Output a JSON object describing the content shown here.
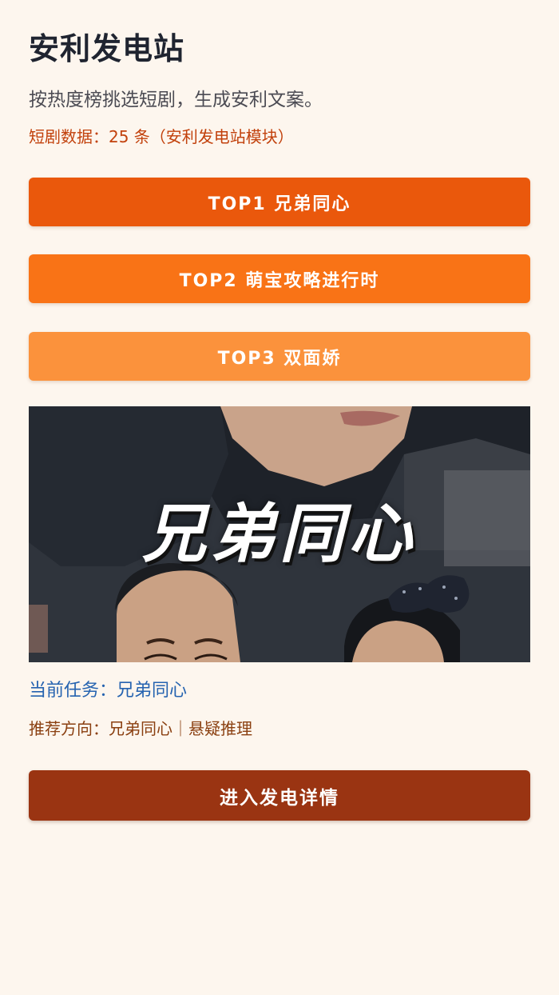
{
  "header": {
    "title": "安利发电站",
    "subtitle": "按热度榜挑选短剧，生成安利文案。",
    "stats": "短剧数据：25 条（安利发电站模块）"
  },
  "top_list": [
    {
      "label": "TOP1 兄弟同心",
      "color": "#ea580c"
    },
    {
      "label": "TOP2 萌宝攻略进行时",
      "color": "#f97316"
    },
    {
      "label": "TOP3 双面娇",
      "color": "#fb923c"
    }
  ],
  "cover": {
    "title_text": "兄弟同心"
  },
  "task": {
    "current": "当前任务：兄弟同心",
    "direction": "推荐方向：兄弟同心｜悬疑推理"
  },
  "actions": {
    "enter_label": "进入发电详情",
    "enter_color": "#9a3412"
  },
  "colors": {
    "background": "#fdf6ee",
    "accent": "#ea580c",
    "task_text": "#2563b0",
    "stats_text": "#c2410c"
  }
}
